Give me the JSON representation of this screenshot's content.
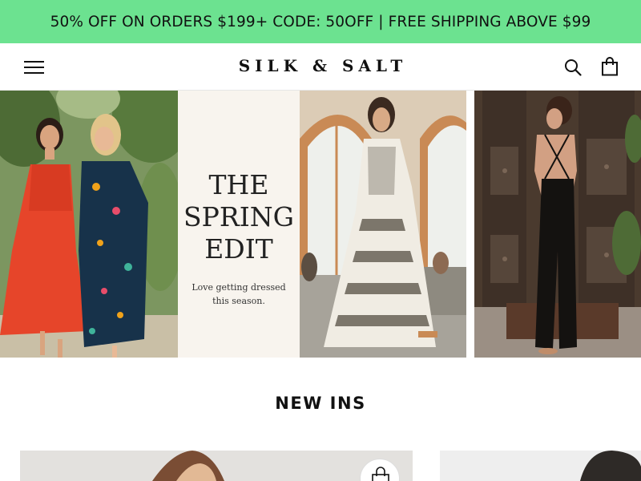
{
  "promo": {
    "text": "50% OFF ON ORDERS $199+ CODE: 50OFF | FREE SHIPPING ABOVE $99",
    "background_color": "#6ce290"
  },
  "header": {
    "logo_text": "SILK & SALT",
    "menu_icon": "hamburger-menu-icon",
    "search_icon": "search-icon",
    "cart_icon": "shopping-bag-icon"
  },
  "hero": {
    "title_line1": "THE",
    "title_line2": "SPRING",
    "title_line3": "EDIT",
    "subtitle_line1": "Love getting dressed",
    "subtitle_line2": "this season."
  },
  "new_ins": {
    "title": "NEW INS",
    "quick_add_icon": "shopping-bag-icon"
  }
}
